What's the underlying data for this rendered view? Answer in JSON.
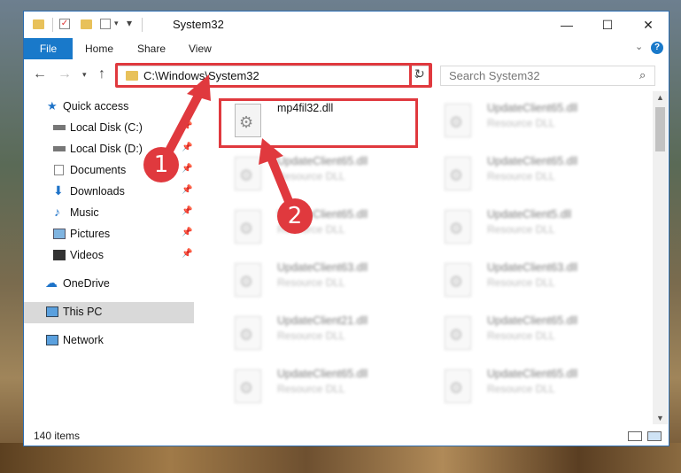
{
  "window": {
    "title": "System32",
    "controls": {
      "minimize": "—",
      "maximize": "☐",
      "close": "✕"
    }
  },
  "ribbon": {
    "tabs": [
      "File",
      "Home",
      "Share",
      "View"
    ],
    "help_label": "?"
  },
  "navigation": {
    "address": "C:\\Windows\\System32",
    "search_placeholder": "Search System32"
  },
  "sidebar": {
    "items": [
      {
        "label": "Quick access",
        "icon": "star-icon"
      },
      {
        "label": "Local Disk (C:)",
        "icon": "drive-icon",
        "pinned": true
      },
      {
        "label": "Local Disk (D:)",
        "icon": "drive-icon",
        "pinned": true
      },
      {
        "label": "Documents",
        "icon": "documents-icon",
        "pinned": true
      },
      {
        "label": "Downloads",
        "icon": "download-icon",
        "pinned": true
      },
      {
        "label": "Music",
        "icon": "music-icon",
        "pinned": true
      },
      {
        "label": "Pictures",
        "icon": "pictures-icon",
        "pinned": true
      },
      {
        "label": "Videos",
        "icon": "videos-icon",
        "pinned": true
      },
      {
        "label": "OneDrive",
        "icon": "cloud-icon"
      },
      {
        "label": "This PC",
        "icon": "computer-icon",
        "selected": true
      },
      {
        "label": "Network",
        "icon": "network-icon"
      }
    ]
  },
  "files": [
    {
      "name": "mp4fil32.dll",
      "type": "",
      "highlighted": true
    },
    {
      "name": "UpdateClient65.dll",
      "type": "Resource DLL"
    },
    {
      "name": "UpdateClient65.dll",
      "type": "Resource DLL"
    },
    {
      "name": "UpdateClient65.dll",
      "type": "Resource DLL"
    },
    {
      "name": "UpdateClient65.dll",
      "type": "Resource DLL"
    },
    {
      "name": "UpdateClient5.dll",
      "type": "Resource DLL"
    },
    {
      "name": "UpdateClient63.dll",
      "type": "Resource DLL"
    },
    {
      "name": "UpdateClient63.dll",
      "type": "Resource DLL"
    },
    {
      "name": "UpdateClient21.dll",
      "type": "Resource DLL"
    },
    {
      "name": "UpdateClient65.dll",
      "type": "Resource DLL"
    },
    {
      "name": "UpdateClient65.dll",
      "type": "Resource DLL"
    },
    {
      "name": "UpdateClient65.dll",
      "type": "Resource DLL"
    }
  ],
  "status": {
    "item_count": "140 items"
  },
  "annotations": {
    "marker_1": "1",
    "marker_2": "2",
    "color": "#e0393e"
  },
  "colors": {
    "accent": "#1979ca",
    "annotation_red": "#e0393e"
  }
}
